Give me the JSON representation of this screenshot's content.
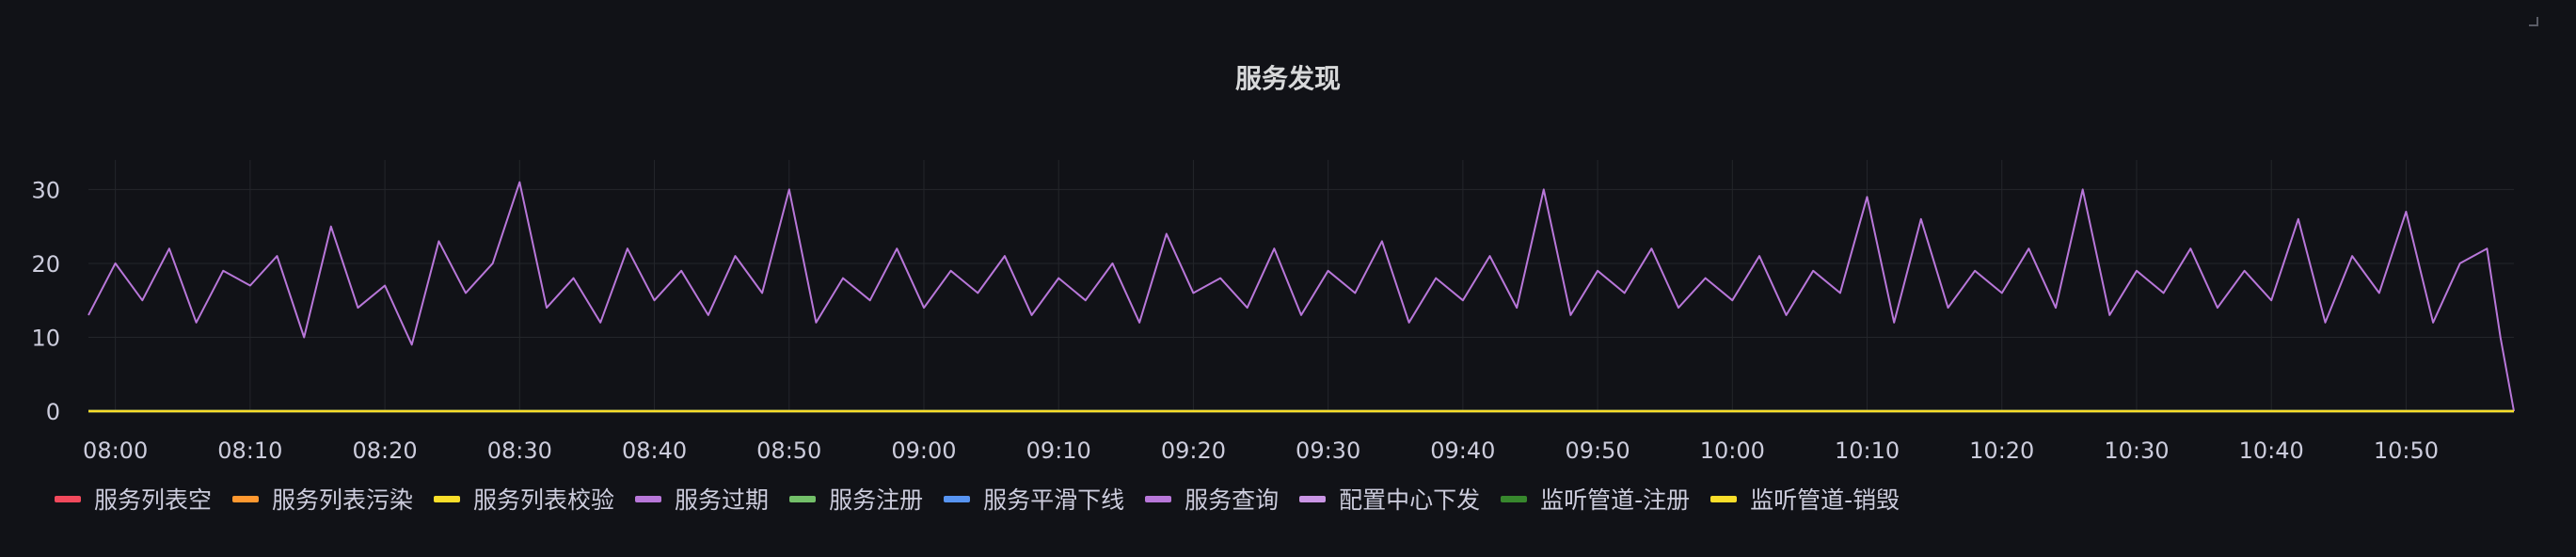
{
  "panel": {
    "title": "服务发现"
  },
  "chart_data": {
    "type": "line",
    "title": "服务发现",
    "xlabel": "",
    "ylabel": "",
    "x_range": [
      "07:58",
      "10:58"
    ],
    "ylim": [
      0,
      34
    ],
    "y_ticks": [
      0,
      10,
      20,
      30
    ],
    "x_ticks": [
      "08:00",
      "08:10",
      "08:20",
      "08:30",
      "08:40",
      "08:50",
      "09:00",
      "09:10",
      "09:20",
      "09:30",
      "09:40",
      "09:50",
      "10:00",
      "10:10",
      "10:20",
      "10:30",
      "10:40",
      "10:50"
    ],
    "grid": true,
    "legend_position": "bottom-left",
    "series": [
      {
        "name": "服务列表空",
        "color": "#f2495c",
        "values_note": "constant",
        "values": [
          [
            "07:58",
            0
          ],
          [
            "10:58",
            0
          ]
        ]
      },
      {
        "name": "服务列表污染",
        "color": "#ff9830",
        "values": [
          [
            "07:58",
            0
          ],
          [
            "10:58",
            0
          ]
        ]
      },
      {
        "name": "服务列表校验",
        "color": "#fade2a",
        "values": [
          [
            "07:58",
            0
          ],
          [
            "10:58",
            0
          ]
        ]
      },
      {
        "name": "服务过期",
        "color": "#b877d9",
        "values": [
          [
            "07:58",
            0
          ],
          [
            "10:58",
            0
          ]
        ]
      },
      {
        "name": "服务注册",
        "color": "#73bf69",
        "values": [
          [
            "07:58",
            0
          ],
          [
            "10:58",
            0
          ]
        ]
      },
      {
        "name": "服务平滑下线",
        "color": "#5794f2",
        "values": [
          [
            "07:58",
            0
          ],
          [
            "10:58",
            0
          ]
        ]
      },
      {
        "name": "服务查询",
        "color": "#b877d9",
        "values": [
          [
            "07:58",
            13
          ],
          [
            "08:00",
            20
          ],
          [
            "08:02",
            15
          ],
          [
            "08:04",
            22
          ],
          [
            "08:06",
            12
          ],
          [
            "08:08",
            19
          ],
          [
            "08:10",
            17
          ],
          [
            "08:12",
            21
          ],
          [
            "08:14",
            10
          ],
          [
            "08:16",
            25
          ],
          [
            "08:18",
            14
          ],
          [
            "08:20",
            17
          ],
          [
            "08:22",
            9
          ],
          [
            "08:24",
            23
          ],
          [
            "08:26",
            16
          ],
          [
            "08:28",
            20
          ],
          [
            "08:30",
            31
          ],
          [
            "08:32",
            14
          ],
          [
            "08:34",
            18
          ],
          [
            "08:36",
            12
          ],
          [
            "08:38",
            22
          ],
          [
            "08:40",
            15
          ],
          [
            "08:42",
            19
          ],
          [
            "08:44",
            13
          ],
          [
            "08:46",
            21
          ],
          [
            "08:48",
            16
          ],
          [
            "08:50",
            30
          ],
          [
            "08:52",
            12
          ],
          [
            "08:54",
            18
          ],
          [
            "08:56",
            15
          ],
          [
            "08:58",
            22
          ],
          [
            "09:00",
            14
          ],
          [
            "09:02",
            19
          ],
          [
            "09:04",
            16
          ],
          [
            "09:06",
            21
          ],
          [
            "09:08",
            13
          ],
          [
            "09:10",
            18
          ],
          [
            "09:12",
            15
          ],
          [
            "09:14",
            20
          ],
          [
            "09:16",
            12
          ],
          [
            "09:18",
            24
          ],
          [
            "09:20",
            16
          ],
          [
            "09:22",
            18
          ],
          [
            "09:24",
            14
          ],
          [
            "09:26",
            22
          ],
          [
            "09:28",
            13
          ],
          [
            "09:30",
            19
          ],
          [
            "09:32",
            16
          ],
          [
            "09:34",
            23
          ],
          [
            "09:36",
            12
          ],
          [
            "09:38",
            18
          ],
          [
            "09:40",
            15
          ],
          [
            "09:42",
            21
          ],
          [
            "09:44",
            14
          ],
          [
            "09:46",
            30
          ],
          [
            "09:48",
            13
          ],
          [
            "09:50",
            19
          ],
          [
            "09:52",
            16
          ],
          [
            "09:54",
            22
          ],
          [
            "09:56",
            14
          ],
          [
            "09:58",
            18
          ],
          [
            "10:00",
            15
          ],
          [
            "10:02",
            21
          ],
          [
            "10:04",
            13
          ],
          [
            "10:06",
            19
          ],
          [
            "10:08",
            16
          ],
          [
            "10:10",
            29
          ],
          [
            "10:12",
            12
          ],
          [
            "10:14",
            26
          ],
          [
            "10:16",
            14
          ],
          [
            "10:18",
            19
          ],
          [
            "10:20",
            16
          ],
          [
            "10:22",
            22
          ],
          [
            "10:24",
            14
          ],
          [
            "10:26",
            30
          ],
          [
            "10:28",
            13
          ],
          [
            "10:30",
            19
          ],
          [
            "10:32",
            16
          ],
          [
            "10:34",
            22
          ],
          [
            "10:36",
            14
          ],
          [
            "10:38",
            19
          ],
          [
            "10:40",
            15
          ],
          [
            "10:42",
            26
          ],
          [
            "10:44",
            12
          ],
          [
            "10:46",
            21
          ],
          [
            "10:48",
            16
          ],
          [
            "10:50",
            27
          ],
          [
            "10:52",
            12
          ],
          [
            "10:54",
            20
          ],
          [
            "10:56",
            22
          ],
          [
            "10:57",
            10
          ],
          [
            "10:58",
            0
          ]
        ]
      },
      {
        "name": "配置中心下发",
        "color": "#ca95e5",
        "values": [
          [
            "07:58",
            0
          ],
          [
            "10:58",
            0
          ]
        ]
      },
      {
        "name": "监听管道-注册",
        "color": "#37872d",
        "values": [
          [
            "07:58",
            0
          ],
          [
            "10:58",
            0
          ]
        ]
      },
      {
        "name": "监听管道-销毁",
        "color": "#fade2a",
        "values": [
          [
            "07:58",
            0
          ],
          [
            "10:58",
            0
          ]
        ]
      }
    ]
  }
}
